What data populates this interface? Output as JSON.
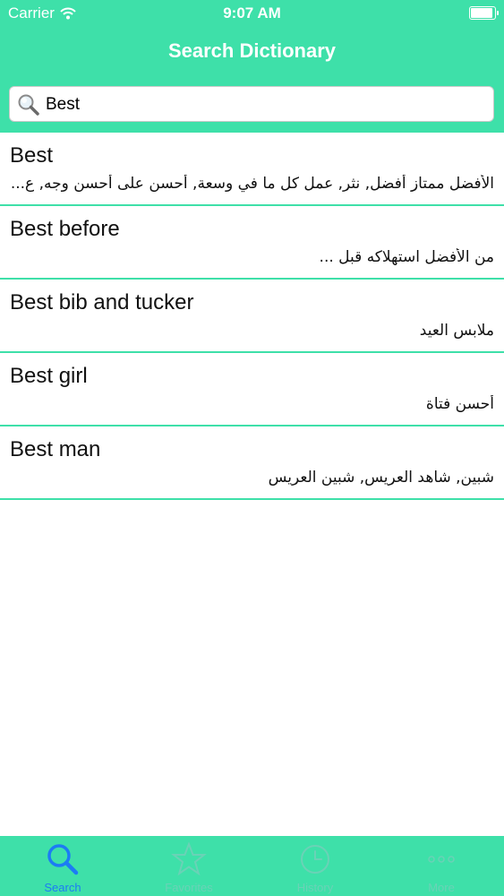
{
  "status_bar": {
    "carrier": "Carrier",
    "time": "9:07 AM"
  },
  "nav": {
    "title": "Search Dictionary"
  },
  "search": {
    "value": "Best",
    "placeholder": ""
  },
  "results": [
    {
      "term": "Best",
      "translation": "الأفضل ممتاز أفضل, نثر, عمل كل ما في وسعة, أحسن على أحسن وجه, ع..."
    },
    {
      "term": "Best before",
      "translation": "من الأفضل استهلاكه قبل ..."
    },
    {
      "term": "Best bib and tucker",
      "translation": "ملابس العيد"
    },
    {
      "term": "Best girl",
      "translation": "أحسن فتاة"
    },
    {
      "term": "Best man",
      "translation": "شبين, شاهد العريس, شبين العريس"
    }
  ],
  "tabs": [
    {
      "label": "Search",
      "icon": "search-icon",
      "active": true
    },
    {
      "label": "Favorites",
      "icon": "star-icon",
      "active": false
    },
    {
      "label": "History",
      "icon": "clock-icon",
      "active": false
    },
    {
      "label": "More",
      "icon": "more-icon",
      "active": false
    }
  ],
  "colors": {
    "accent": "#3ee0a9",
    "active_tab": "#1c7cf4",
    "inactive_tab": "#6ad2b6"
  }
}
